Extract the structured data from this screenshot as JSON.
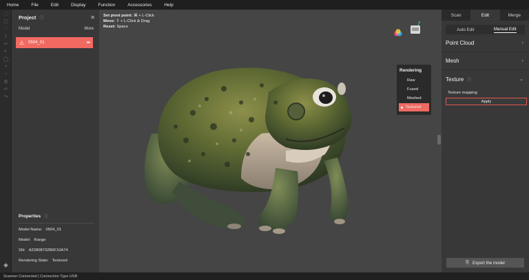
{
  "menu": [
    "Home",
    "File",
    "Edit",
    "Display",
    "Function",
    "Accessories",
    "Help"
  ],
  "project": {
    "title": "Project",
    "col_model": "Model",
    "col_more": "More",
    "selected_model": "0504_01"
  },
  "properties": {
    "title": "Properties",
    "rows": [
      {
        "key": "Model Name:",
        "value": "0504_01"
      },
      {
        "key": "Model:",
        "value": "Range"
      },
      {
        "key": "SN:",
        "value": "A22808732B6F10A74"
      },
      {
        "key": "Rendering State:",
        "value": "Textured"
      }
    ]
  },
  "viewport": {
    "hints": [
      {
        "label": "Set pivot point:",
        "value": "⌘ + L-Click"
      },
      {
        "label": "Move:",
        "value": "⇧ + L-Click & Drag"
      },
      {
        "label": "Reset:",
        "value": "Space"
      }
    ],
    "rendering": {
      "title": "Rendering",
      "options": [
        "Raw",
        "Fused",
        "Meshed",
        "Textured"
      ],
      "selected": "Textured"
    }
  },
  "right_panel": {
    "tabs": [
      "Scan",
      "Edit",
      "Merge"
    ],
    "active_tab": "Edit",
    "subtabs": [
      "Auto Edit",
      "Manual Edit"
    ],
    "active_subtab": "Manual Edit",
    "sections": [
      "Point Cloud",
      "Mesh",
      "Texture"
    ],
    "texture_mapping_label": "Texture mapping",
    "apply_label": "Apply",
    "export_label": "Export the model"
  },
  "status_text": "Scanner Connected | Connection Type USB",
  "colors": {
    "accent": "#f16a62",
    "panel": "#383838",
    "viewport": "#454545",
    "menubar": "#1f1f1f"
  }
}
